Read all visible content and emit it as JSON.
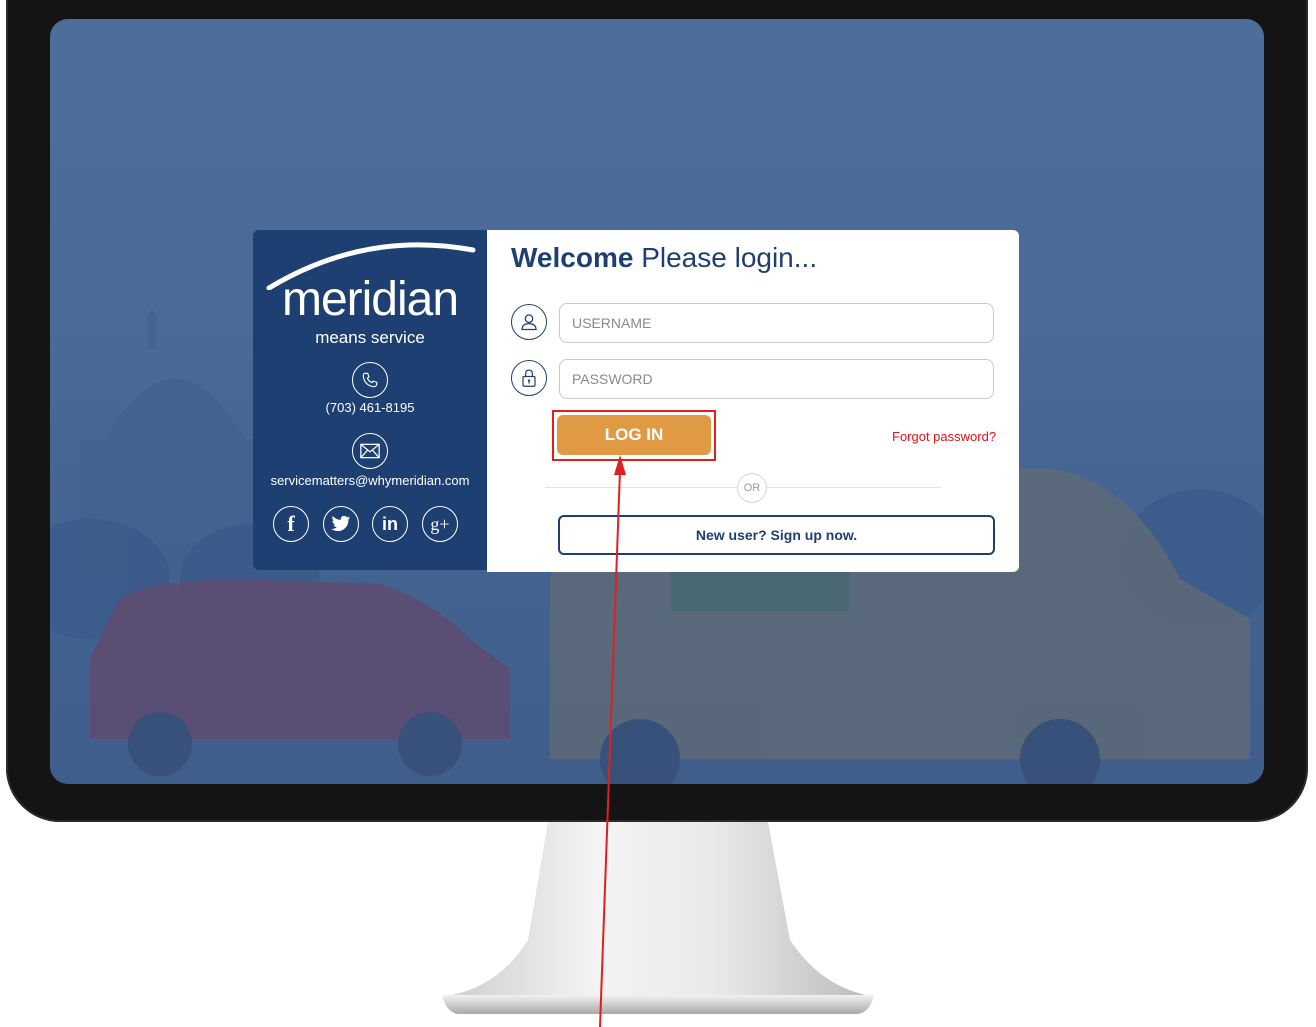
{
  "brand": {
    "logo_text": "meridian",
    "tagline": "means service",
    "phone": "(703) 461-8195",
    "email": "servicematters@whymeridian.com",
    "social": [
      {
        "name": "facebook-icon",
        "glyph": "f"
      },
      {
        "name": "twitter-icon",
        "glyph": "t"
      },
      {
        "name": "linkedin-icon",
        "glyph": "in"
      },
      {
        "name": "google-plus-icon",
        "glyph": "g+"
      }
    ]
  },
  "login": {
    "welcome_bold": "Welcome",
    "welcome_rest": "Please login...",
    "username_placeholder": "USERNAME",
    "password_placeholder": "PASSWORD",
    "login_label": "LOG IN",
    "forgot_label": "Forgot password?",
    "or_label": "OR",
    "signup_label": "New user? Sign up now."
  },
  "colors": {
    "brand_navy": "#1e3f72",
    "login_orange": "#e09a44",
    "forgot_red": "#e0121a",
    "annotation_red": "#e02020",
    "screen_blue": "#4a6a98"
  }
}
